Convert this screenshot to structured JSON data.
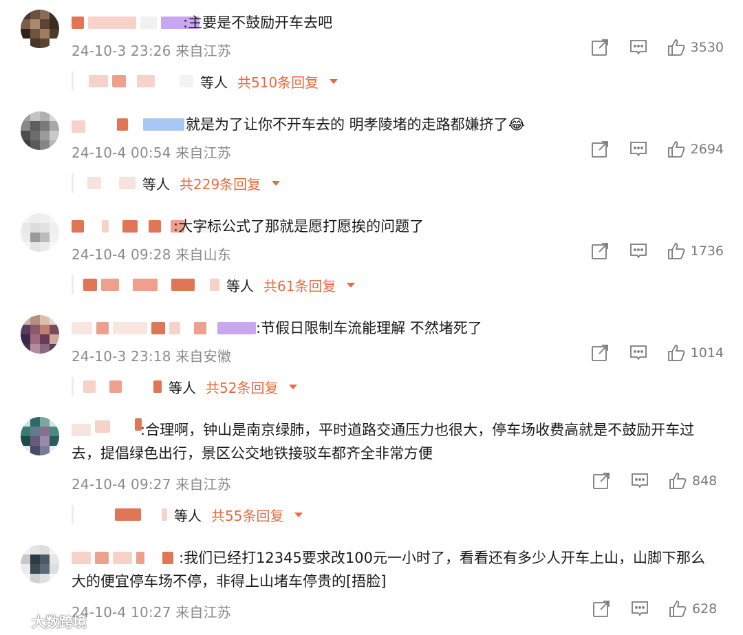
{
  "comments": [
    {
      "text": ":主要是不鼓励开车去吧",
      "time": "24-10-3 23:26",
      "location": "来自江苏",
      "likes": "3530",
      "reply_deng": "等人",
      "reply_total": "共510条回复"
    },
    {
      "text": "就是为了让你不开车去的 明孝陵堵的走路都嫌挤了",
      "emoji": "😂",
      "time": "24-10-4 00:54",
      "location": "来自江苏",
      "likes": "2694",
      "reply_deng": "等人",
      "reply_total": "共229条回复"
    },
    {
      "text": ":大字标公式了那就是愿打愿挨的问题了",
      "time": "24-10-4 09:28",
      "location": "来自山东",
      "likes": "1736",
      "reply_deng": "等人",
      "reply_total": "共61条回复"
    },
    {
      "text": ":节假日限制车流能理解 不然堵死了",
      "time": "24-10-3 23:18",
      "location": "来自安徽",
      "likes": "1014",
      "reply_deng": "等人",
      "reply_total": "共52条回复"
    },
    {
      "text": ":合理啊，钟山是南京绿肺，平时道路交通压力也很大，停车场收费高就是不鼓励开车过去，提倡绿色出行，景区公交地铁接驳车都齐全非常方便",
      "time": "24-10-4 09:27",
      "location": "来自江苏",
      "likes": "848",
      "reply_deng": "等人",
      "reply_total": "共55条回复"
    },
    {
      "text": ":我们已经打12345要求改100元一小时了，看看还有多少人开车上山，山脚下那么大的便宜停车场不停，非得上山堵车停贵的[捂脸]",
      "time": "24-10-4 10:27",
      "location": "来自江苏",
      "likes": "628"
    }
  ],
  "watermark": "大数跨境",
  "colors": {
    "accent": "#e86a3c",
    "meta": "#8a8a8a"
  },
  "icons": {
    "share": "share-icon",
    "reply": "comment-icon",
    "like": "thumbs-up-icon",
    "caret": "caret-down-icon"
  }
}
